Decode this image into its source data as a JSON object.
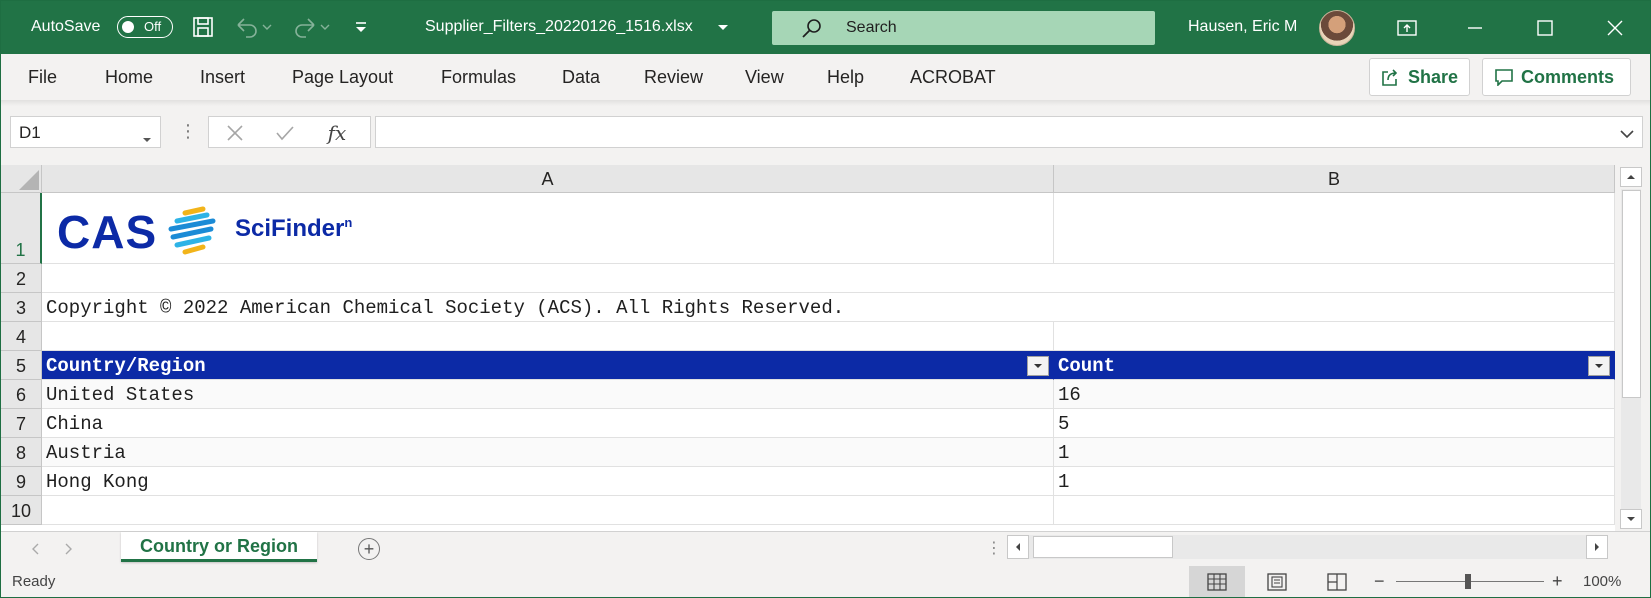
{
  "titlebar": {
    "autosave_label": "AutoSave",
    "autosave_state": "Off",
    "filename": "Supplier_Filters_20220126_1516.xlsx",
    "search_placeholder": "Search",
    "user_name": "Hausen, Eric M"
  },
  "menu": {
    "items": [
      "File",
      "Home",
      "Insert",
      "Page Layout",
      "Formulas",
      "Data",
      "Review",
      "View",
      "Help",
      "ACROBAT"
    ],
    "share_label": "Share",
    "comments_label": "Comments"
  },
  "formula_bar": {
    "name_box": "D1",
    "fx_label": "fx",
    "formula_value": ""
  },
  "sheet": {
    "columns": [
      "A",
      "B"
    ],
    "rows": [
      "1",
      "2",
      "3",
      "4",
      "5",
      "6",
      "7",
      "8",
      "9",
      "10"
    ],
    "logo_text": "CAS",
    "logo_product": "SciFinder",
    "logo_product_sup": "n",
    "copyright": "Copyright © 2022 American Chemical Society (ACS).  All Rights Reserved.",
    "table_headers": [
      "Country/Region",
      "Count"
    ],
    "table_rows": [
      [
        "United States",
        "16"
      ],
      [
        "China",
        "5"
      ],
      [
        "Austria",
        "1"
      ],
      [
        "Hong Kong",
        "1"
      ]
    ]
  },
  "tabs": {
    "active_sheet": "Country or Region",
    "add_symbol": "+"
  },
  "status": {
    "state": "Ready",
    "zoom_minus": "−",
    "zoom_plus": "+",
    "zoom_level": "100%"
  },
  "colors": {
    "excel_green": "#217346",
    "table_header": "#0c2aa6"
  }
}
